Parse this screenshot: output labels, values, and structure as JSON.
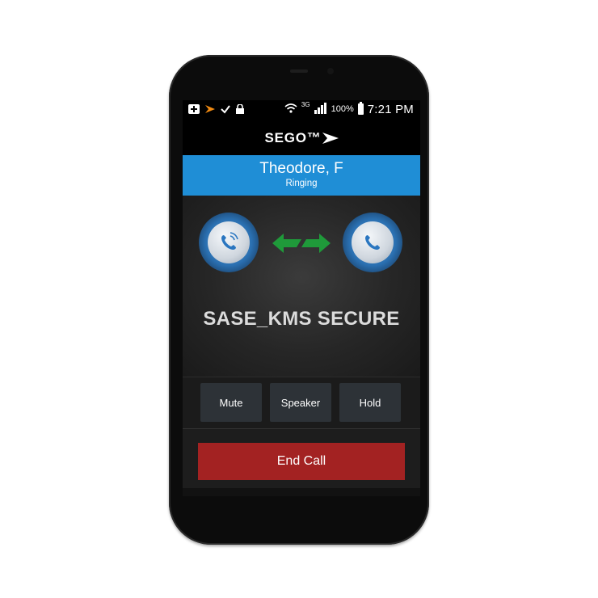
{
  "statusbar": {
    "network_label": "3G",
    "battery_pct": "100%",
    "time": "7:21 PM"
  },
  "app": {
    "logo": "SEGO™"
  },
  "contact": {
    "name": "Theodore, F",
    "status": "Ringing"
  },
  "call": {
    "security_label": "SASE_KMS SECURE"
  },
  "controls": {
    "mute": "Mute",
    "speaker": "Speaker",
    "hold": "Hold"
  },
  "end_call": {
    "label": "End Call"
  },
  "colors": {
    "contact_bar": "#1f8ed6",
    "end_call": "#a32222",
    "arrow": "#1f9a3a"
  }
}
